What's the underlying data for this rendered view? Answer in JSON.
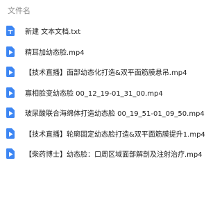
{
  "header": {
    "name_column": "文件名"
  },
  "colors": {
    "file_icon": "#3d86f3"
  },
  "files": [
    {
      "name": "新建 文本文档.txt",
      "icon": "text-file-icon"
    },
    {
      "name": "精耳加幼态脸.mp4",
      "icon": "video-file-icon"
    },
    {
      "name": "【技术直播】面部幼态化打造&双平面筋膜悬吊.mp4",
      "icon": "video-file-icon"
    },
    {
      "name": "寡相脸变幼态脸 00_12_19-01_31_00.mp4",
      "icon": "video-file-icon"
    },
    {
      "name": "玻尿酸联合海绵体打造幼态脸 00_19_51-01_09_50.mp4",
      "icon": "video-file-icon"
    },
    {
      "name": "【技术直播】轮廓固定幼态脸打造&双平面筋膜提升1.mp4",
      "icon": "video-file-icon"
    },
    {
      "name": "【柴药博士】幼态脸：口周区域面部解剖及注射治疗.mp4",
      "icon": "video-file-icon"
    }
  ]
}
